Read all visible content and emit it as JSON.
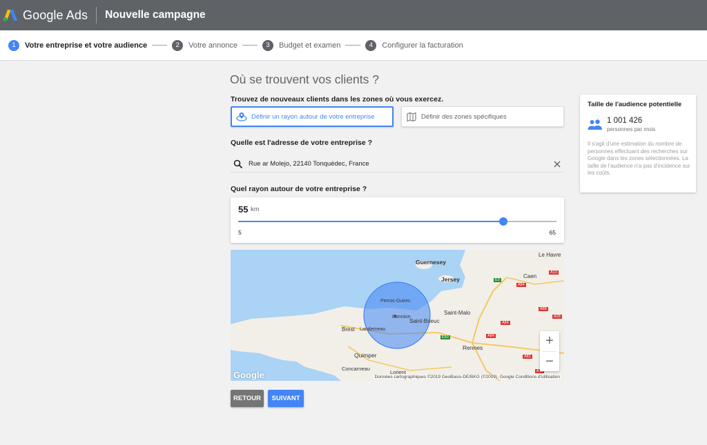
{
  "header": {
    "brand": "Google Ads",
    "campaign_title": "Nouvelle campagne",
    "icon": "google-ads-logo"
  },
  "stepper": {
    "steps": [
      {
        "num": "1",
        "label": "Votre entreprise et votre audience",
        "active": true
      },
      {
        "num": "2",
        "label": "Votre annonce",
        "active": false
      },
      {
        "num": "3",
        "label": "Budget et examen",
        "active": false
      },
      {
        "num": "4",
        "label": "Configurer la facturation",
        "active": false
      }
    ]
  },
  "main": {
    "title": "Où se trouvent vos clients ?",
    "intro": "Trouvez de nouveaux clients dans les zones où vous exercez.",
    "options": [
      {
        "label": "Définir un rayon autour de votre entreprise",
        "icon": "radius-pin-icon",
        "selected": true
      },
      {
        "label": "Définir des zones spécifiques",
        "icon": "zones-icon",
        "selected": false
      }
    ],
    "address_label": "Quelle est l'adresse de votre entreprise ?",
    "address_value": "Rue ar Molejo, 22140 Tonquédec, France",
    "radius_label": "Quel rayon autour de votre entreprise ?",
    "radius": {
      "value": "55",
      "unit": "km",
      "min": "5",
      "max": "65",
      "fraction": 0.8333
    }
  },
  "map": {
    "labels": [
      "Guernesey",
      "Jersey",
      "Le Havre",
      "Caen",
      "Saint-Malo",
      "Perros-Guirec",
      "Lannion",
      "Saint-Brieuc",
      "Brest",
      "Landerneau",
      "Rennes",
      "Quimper",
      "Concarneau",
      "Lorient"
    ],
    "road_labels": [
      "A13",
      "E3",
      "A84",
      "A28",
      "A88",
      "A84",
      "E50",
      "A84",
      "A81",
      "A11"
    ],
    "zoom_in": "+",
    "zoom_out": "−",
    "google_mark": "Google",
    "attribution": "Données cartographiques ©2019 GeoBasis-DE/BKG (©2009), Google    Conditions d'utilisation"
  },
  "buttons": {
    "back": "RETOUR",
    "next": "SUIVANT"
  },
  "audience": {
    "title": "Taille de l'audience potentielle",
    "count": "1 001 426",
    "count_sub": "personnes par mois",
    "description": "Il s'agit d'une estimation du nombre de personnes effectuant des recherches sur Google dans les zones sélectionnées. La taille de l'audience n'a pas d'incidence sur les coûts."
  },
  "colors": {
    "accent": "#4285f4",
    "header_bg": "#5f6368",
    "water": "#aad3f5",
    "land": "#f2efe9"
  }
}
